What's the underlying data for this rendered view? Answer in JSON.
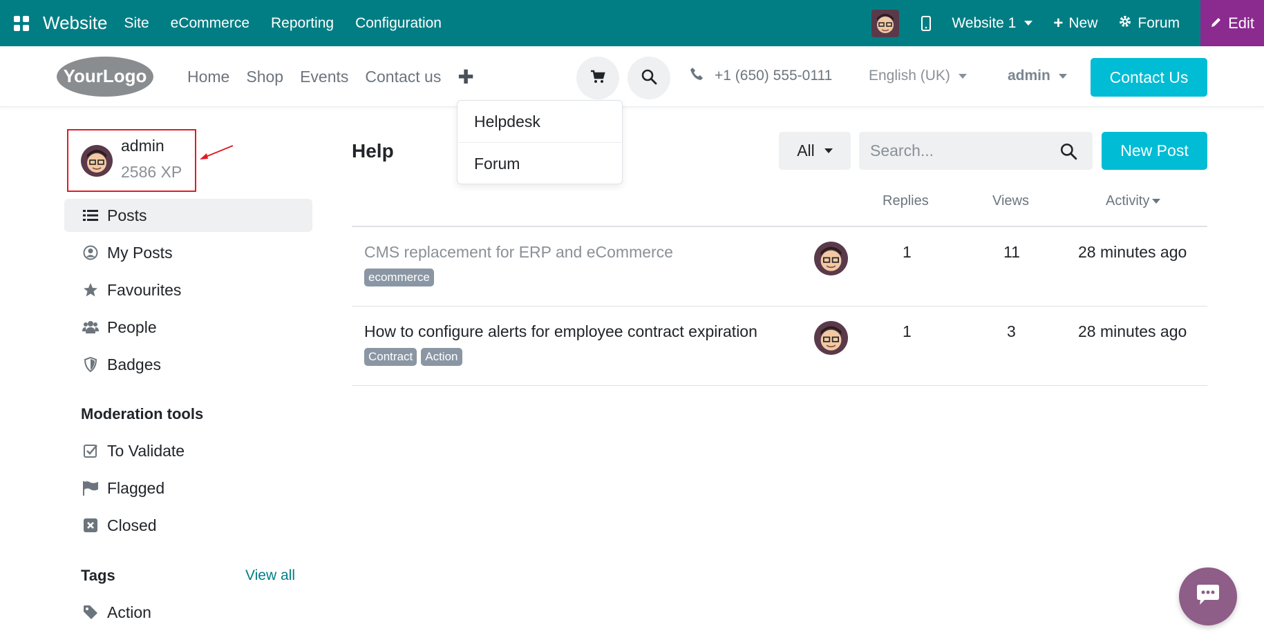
{
  "topbar": {
    "brand": "Website",
    "menu": [
      "Site",
      "eCommerce",
      "Reporting",
      "Configuration"
    ],
    "website_selector": "Website 1",
    "new_label": "New",
    "forum_label": "Forum",
    "edit_label": "Edit",
    "color": "#017e84",
    "edit_color": "#8b2a8f"
  },
  "header": {
    "logo_text": "YourLogo",
    "nav": [
      "Home",
      "Shop",
      "Events",
      "Contact us"
    ],
    "phone": "+1 (650) 555-0111",
    "language": "English (UK)",
    "user": "admin",
    "contact_button": "Contact Us",
    "accent": "#00bcd4"
  },
  "dropdown": {
    "items": [
      "Helpdesk",
      "Forum"
    ]
  },
  "sidebar": {
    "user_name": "admin",
    "user_xp": "2586 XP",
    "items": [
      {
        "label": "Posts",
        "icon": "list-icon",
        "active": true
      },
      {
        "label": "My Posts",
        "icon": "user-circle-icon"
      },
      {
        "label": "Favourites",
        "icon": "star-icon"
      },
      {
        "label": "People",
        "icon": "users-icon"
      },
      {
        "label": "Badges",
        "icon": "shield-icon"
      }
    ],
    "moderation_title": "Moderation tools",
    "moderation_items": [
      {
        "label": "To Validate",
        "icon": "check-square-icon"
      },
      {
        "label": "Flagged",
        "icon": "flag-icon"
      },
      {
        "label": "Closed",
        "icon": "close-square-icon"
      }
    ],
    "tags_title": "Tags",
    "view_all": "View all",
    "tags": [
      {
        "label": "Action",
        "icon": "tag-icon"
      }
    ]
  },
  "main": {
    "title": "Help",
    "filter": "All",
    "search_placeholder": "Search...",
    "new_post": "New Post",
    "columns": {
      "replies": "Replies",
      "views": "Views",
      "activity": "Activity"
    },
    "posts": [
      {
        "title": "CMS replacement for ERP and eCommerce",
        "tags": [
          "ecommerce"
        ],
        "replies": "1",
        "views": "11",
        "activity": "28 minutes ago"
      },
      {
        "title": "How to configure alerts for employee contract expiration",
        "tags": [
          "Contract",
          "Action"
        ],
        "replies": "1",
        "views": "3",
        "activity": "28 minutes ago"
      }
    ]
  }
}
